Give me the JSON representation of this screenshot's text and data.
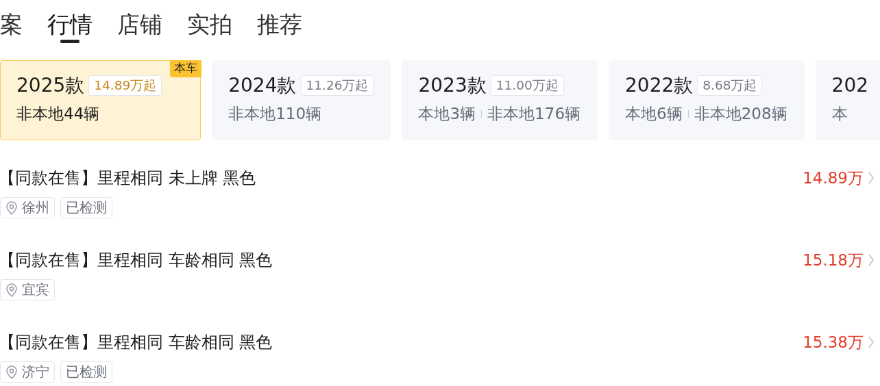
{
  "tabs": [
    {
      "label": "案",
      "selected": false
    },
    {
      "label": "行情",
      "selected": true
    },
    {
      "label": "店铺",
      "selected": false
    },
    {
      "label": "实拍",
      "selected": false
    },
    {
      "label": "推荐",
      "selected": false
    }
  ],
  "model_years": [
    {
      "year": "2025款",
      "price": "14.89万起",
      "counts": [
        "非本地44辆"
      ],
      "selected": true,
      "badge": "本车"
    },
    {
      "year": "2024款",
      "price": "11.26万起",
      "counts": [
        "非本地110辆"
      ],
      "selected": false
    },
    {
      "year": "2023款",
      "price": "11.00万起",
      "counts": [
        "本地3辆",
        "非本地176辆"
      ],
      "selected": false
    },
    {
      "year": "2022款",
      "price": "8.68万起",
      "counts": [
        "本地6辆",
        "非本地208辆"
      ],
      "selected": false
    },
    {
      "year": "202",
      "counts": [
        "本"
      ],
      "selected": false
    }
  ],
  "listings": [
    {
      "title": "【同款在售】里程相同 未上牌 黑色",
      "price": "14.89万",
      "tags": [
        {
          "kind": "location",
          "text": "徐州"
        },
        {
          "kind": "plain",
          "text": "已检测"
        }
      ]
    },
    {
      "title": "【同款在售】里程相同 车龄相同 黑色",
      "price": "15.18万",
      "tags": [
        {
          "kind": "location",
          "text": "宜宾"
        }
      ]
    },
    {
      "title": "【同款在售】里程相同 车龄相同 黑色",
      "price": "15.38万",
      "tags": [
        {
          "kind": "location",
          "text": "济宁"
        },
        {
          "kind": "plain",
          "text": "已检测"
        }
      ]
    }
  ]
}
